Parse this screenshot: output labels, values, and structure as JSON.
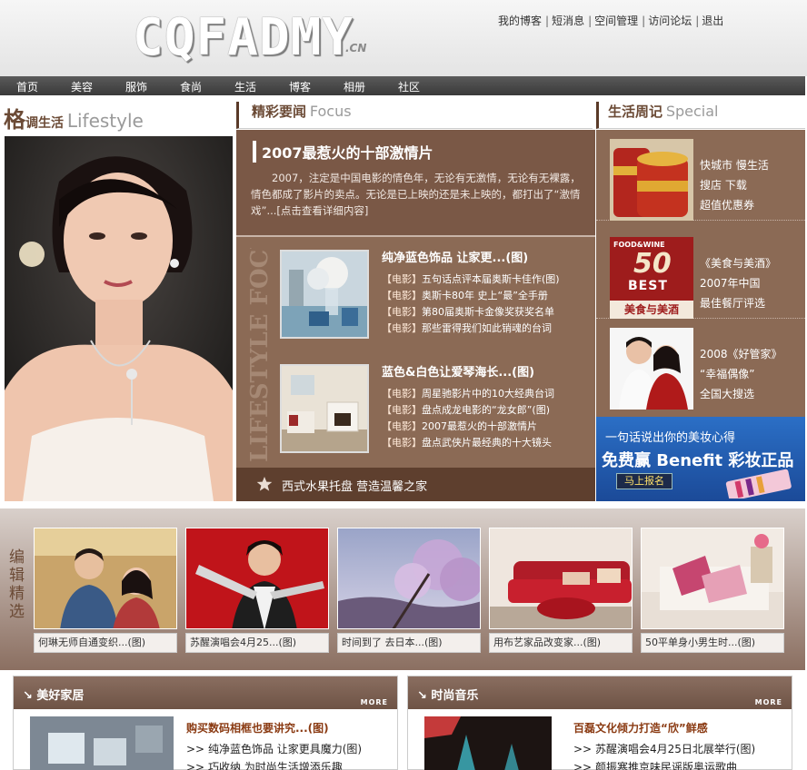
{
  "header": {
    "logo": "CQFADMY",
    "logo_suffix": ".CN",
    "links": [
      "我的博客",
      "短消息",
      "空间管理",
      "访问论坛",
      "退出"
    ]
  },
  "nav": [
    "首页",
    "美容",
    "服饰",
    "食尚",
    "生活",
    "博客",
    "相册",
    "社区"
  ],
  "left": {
    "head_big": "格",
    "head_cn": "调生活",
    "head_en": "Lifestyle"
  },
  "focus": {
    "head_cn": "精彩要闻",
    "head_en": "Focus",
    "title": "2007最惹火的十部激情片",
    "text": "2007，注定是中国电影的情色年，无论有无激情，无论有无裸露，情色都成了影片的卖点。无论是已上映的还是未上映的，都打出了“激情戏”...[点击查看详细内容]",
    "vertical_text": "LIFESTYLE FOCUS",
    "blocks": [
      {
        "headline": "纯净蓝色饰品  让家更...(图)",
        "items": [
          {
            "tag": "【电影】",
            "text": "五句话点评本届奥斯卡佳作(图)"
          },
          {
            "tag": "【电影】",
            "text": "奥斯卡80年 史上“最”全手册"
          },
          {
            "tag": "【电影】",
            "text": "第80届奥斯卡金像奖获奖名单"
          },
          {
            "tag": "【电影】",
            "text": "那些雷得我们如此销魂的台词"
          }
        ]
      },
      {
        "headline": "蓝色&白色让爱琴海长...(图)",
        "items": [
          {
            "tag": "【电影】",
            "text": "周星驰影片中的10大经典台词"
          },
          {
            "tag": "【电影】",
            "text": "盘点成龙电影的“龙女郎”(图)"
          },
          {
            "tag": "【电影】",
            "text": "2007最惹火的十部激情片"
          },
          {
            "tag": "【电影】",
            "text": "盘点武侠片最经典的十大镜头"
          }
        ]
      }
    ],
    "bottom": "西式水果托盘   营造温馨之家"
  },
  "special": {
    "head_cn": "生活周记",
    "head_en": "Special",
    "items": [
      {
        "lines": [
          "快城市 慢生活",
          "搜店 下载",
          "超值优惠券"
        ]
      },
      {
        "lines": [
          "《美食与美酒》",
          "2007年中国",
          "最佳餐厅评选"
        ],
        "badge_top": "FOOD&WINE",
        "badge_num": "50",
        "badge_best": "BEST",
        "badge_cn": "美食与美酒"
      },
      {
        "lines": [
          "2008《好管家》",
          "“幸福偶像”",
          "全国大搜选"
        ]
      }
    ],
    "benefit": {
      "line1": "一句话说出你的美妆心得",
      "line2": "免费赢 Benefit 彩妆正品",
      "button": "马上报名"
    }
  },
  "picks": {
    "label": "编辑精选",
    "items": [
      {
        "caption": "何琳无师自通变织...(图)"
      },
      {
        "caption": "苏醒演唱会4月25...(图)"
      },
      {
        "caption": "时间到了  去日本...(图)"
      },
      {
        "caption": "用布艺家品改变家...(图)"
      },
      {
        "caption": "50平单身小男生时...(图)"
      }
    ]
  },
  "panels": [
    {
      "title": "美好家居",
      "more": "MORE",
      "headline": "购买数码相框也要讲究...(图)",
      "items": [
        "纯净蓝色饰品  让家更具魔力(图)",
        "巧收纳  为时尚生活增添乐趣"
      ]
    },
    {
      "title": "时尚音乐",
      "more": "MORE",
      "headline": "百磊文化倾力打造“欣”鲜感",
      "items": [
        "苏醒演唱会4月25日北展举行(图)",
        "颜振寒推京味民谣版奥运歌曲"
      ]
    }
  ]
}
